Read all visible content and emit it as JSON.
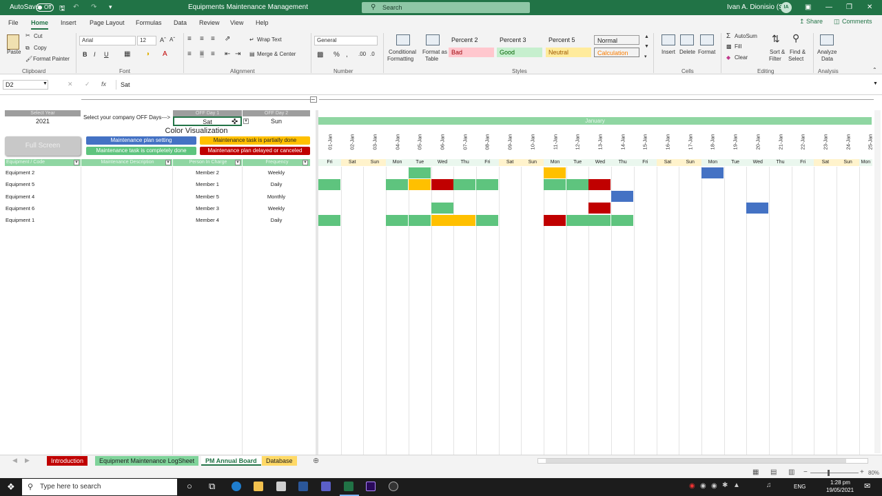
{
  "titlebar": {
    "autosave_label": "AutoSave",
    "autosave_state": "Off",
    "doc_title": "Equipments Maintenance Management",
    "search_placeholder": "Search",
    "user_name": "Ivan A. Dionisio (SK)",
    "user_initials": "IA"
  },
  "ribbon_tabs": [
    "File",
    "Home",
    "Insert",
    "Page Layout",
    "Formulas",
    "Data",
    "Review",
    "View",
    "Help"
  ],
  "share_label": "Share",
  "comments_label": "Comments",
  "ribbon": {
    "paste": "Paste",
    "cut": "Cut",
    "copy": "Copy",
    "format_painter": "Format Painter",
    "clipboard": "Clipboard",
    "font_name": "Arial",
    "font_size": "12",
    "font": "Font",
    "wrap_text": "Wrap Text",
    "merge_center": "Merge & Center",
    "alignment": "Alignment",
    "number_format": "General",
    "number": "Number",
    "cond_format1": "Conditional",
    "cond_format2": "Formatting",
    "format_table1": "Format as",
    "format_table2": "Table",
    "styles": "Styles",
    "style_boxes": [
      {
        "label": "Percent 2",
        "bg": "#ffffff",
        "color": "#222222"
      },
      {
        "label": "Percent 3",
        "bg": "#ffffff",
        "color": "#222222"
      },
      {
        "label": "Percent 5",
        "bg": "#ffffff",
        "color": "#222222"
      },
      {
        "label": "Normal",
        "bg": "#ffffff",
        "color": "#222222"
      },
      {
        "label": "Bad",
        "bg": "#ffc7ce",
        "color": "#9c0006"
      },
      {
        "label": "Good",
        "bg": "#c6efce",
        "color": "#006100"
      },
      {
        "label": "Neutral",
        "bg": "#ffeb9c",
        "color": "#9c5700"
      },
      {
        "label": "Calculation",
        "bg": "#f2f2f2",
        "color": "#fa7d00"
      }
    ],
    "insert": "Insert",
    "delete": "Delete",
    "format": "Format",
    "cells": "Cells",
    "autosum": "AutoSum",
    "fill": "Fill",
    "clear": "Clear",
    "sort1": "Sort &",
    "sort2": "Filter",
    "find1": "Find &",
    "find2": "Select",
    "editing": "Editing",
    "analyze1": "Analyze",
    "analyze2": "Data",
    "analysis": "Analysis"
  },
  "formula_bar": {
    "name_box": "D2",
    "fx": "fx",
    "value": "Sat"
  },
  "sheet": {
    "select_year_hdr": "Select Year",
    "year": "2021",
    "off_days_prompt": "Select your company  OFF Days--->",
    "off_day1_hdr": "OFF Day 1",
    "off_day1": "Sat",
    "off_day2_hdr": "OFF Day 2",
    "off_day2": "Sun",
    "color_vis_title": "Color Visualization",
    "full_screen": "Full Screen",
    "legend": [
      {
        "label": "Maintenance plan setting",
        "bg": "#4472c4",
        "color": "#ffffff"
      },
      {
        "label": "Maintenance task is partially done",
        "bg": "#ffc000",
        "color": "#222222"
      },
      {
        "label": "Maintenance task is completely done",
        "bg": "#5ec47e",
        "color": "#ffffff"
      },
      {
        "label": "Maintenance plan delayed or canceled",
        "bg": "#c00000",
        "color": "#ffffff"
      }
    ],
    "col_headers": [
      "Equipment / Code",
      "Maintenance Description",
      "Person In Charge",
      "Frequency"
    ],
    "month": "January",
    "dates": [
      "01-Jan",
      "02-Jan",
      "03-Jan",
      "04-Jan",
      "05-Jan",
      "06-Jan",
      "07-Jan",
      "08-Jan",
      "09-Jan",
      "10-Jan",
      "11-Jan",
      "12-Jan",
      "13-Jan",
      "14-Jan",
      "15-Jan",
      "16-Jan",
      "17-Jan",
      "18-Jan",
      "19-Jan",
      "20-Jan",
      "21-Jan",
      "22-Jan",
      "23-Jan",
      "24-Jan",
      "25-Jan"
    ],
    "days": [
      "Fri",
      "Sat",
      "Sun",
      "Mon",
      "Tue",
      "Wed",
      "Thu",
      "Fri",
      "Sat",
      "Sun",
      "Mon",
      "Tue",
      "Wed",
      "Thu",
      "Fri",
      "Sat",
      "Sun",
      "Mon",
      "Tue",
      "Wed",
      "Thu",
      "Fri",
      "Sat",
      "Sun",
      "Mon"
    ],
    "rows": [
      {
        "equipment": "Equipment 2",
        "person": "Member 2",
        "frequency": "Weekly",
        "cells": [
          "",
          "",
          "",
          "",
          "G",
          "",
          "",
          "",
          "",
          "",
          "Y",
          "",
          "",
          "",
          "",
          "",
          "",
          "B",
          "",
          "",
          "",
          "",
          "",
          "",
          ""
        ]
      },
      {
        "equipment": "Equipment 5",
        "person": "Member 1",
        "frequency": "Daily",
        "cells": [
          "G",
          "",
          "",
          "G",
          "Y",
          "R",
          "G",
          "G",
          "",
          "",
          "G",
          "G",
          "R",
          "",
          "",
          "",
          "",
          "",
          "",
          "",
          "",
          "",
          "",
          "",
          ""
        ]
      },
      {
        "equipment": "Equipment 4",
        "person": "Member 5",
        "frequency": "Monthly",
        "cells": [
          "",
          "",
          "",
          "",
          "",
          "",
          "",
          "",
          "",
          "",
          "",
          "",
          "",
          "B",
          "",
          "",
          "",
          "",
          "",
          "",
          "",
          "",
          "",
          "",
          ""
        ]
      },
      {
        "equipment": "Equipment 6",
        "person": "Member 3",
        "frequency": "Weekly",
        "cells": [
          "",
          "",
          "",
          "",
          "",
          "G",
          "",
          "",
          "",
          "",
          "",
          "",
          "R",
          "",
          "",
          "",
          "",
          "",
          "",
          "B",
          "",
          "",
          "",
          "",
          ""
        ]
      },
      {
        "equipment": "Equipment 1",
        "person": "Member 4",
        "frequency": "Daily",
        "cells": [
          "G",
          "",
          "",
          "G",
          "G",
          "Y",
          "Y",
          "G",
          "",
          "",
          "R",
          "G",
          "G",
          "G",
          "",
          "",
          "",
          "",
          "",
          "",
          "",
          "",
          "",
          "",
          ""
        ]
      }
    ],
    "cell_colors": {
      "G": "#5ec47e",
      "Y": "#ffc000",
      "R": "#c00000",
      "B": "#4472c4"
    }
  },
  "sheet_tabs": [
    {
      "label": "Introduction",
      "bg": "#c00000",
      "color": "#ffffff"
    },
    {
      "label": "Equipment Maintenance LogSheet",
      "bg": "#7fd39a",
      "color": "#1c1c1c"
    },
    {
      "label": "PM Annual Board",
      "bg": "#ffffff",
      "color": "#217346"
    },
    {
      "label": "Database",
      "bg": "#ffd966",
      "color": "#1c1c1c"
    }
  ],
  "statusbar": {
    "zoom": "80%"
  },
  "taskbar": {
    "search_placeholder": "Type here to search",
    "lang": "ENG",
    "time": "1:28 pm",
    "date": "19/05/2021"
  }
}
